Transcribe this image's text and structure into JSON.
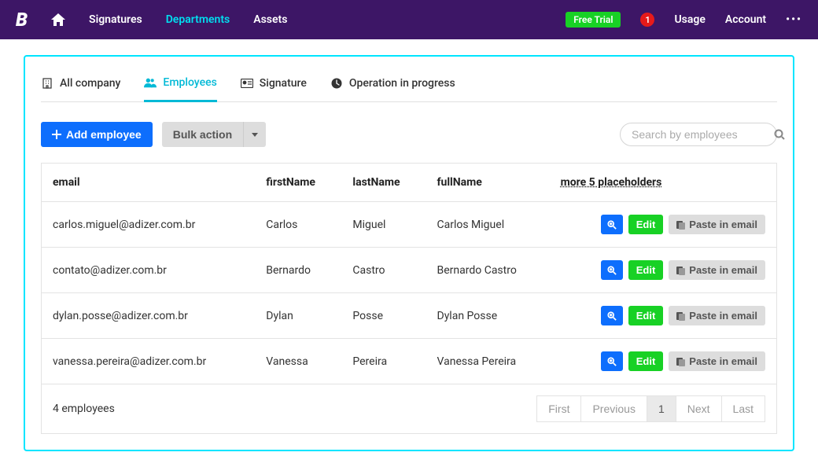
{
  "brand": "B",
  "nav": {
    "items": [
      {
        "label": "Signatures",
        "active": false
      },
      {
        "label": "Departments",
        "active": true
      },
      {
        "label": "Assets",
        "active": false
      }
    ],
    "free_trial": "Free Trial",
    "badge": "1",
    "usage": "Usage",
    "account": "Account",
    "more": "•••"
  },
  "tabs": [
    {
      "label": "All company"
    },
    {
      "label": "Employees"
    },
    {
      "label": "Signature"
    },
    {
      "label": "Operation in progress"
    }
  ],
  "toolbar": {
    "add_employee": "Add employee",
    "bulk_action": "Bulk action",
    "search_placeholder": "Search by employees"
  },
  "table": {
    "headers": {
      "email": "email",
      "firstName": "firstName",
      "lastName": "lastName",
      "fullName": "fullName",
      "more": "more 5 placeholders"
    },
    "rows": [
      {
        "email": "carlos.miguel@adizer.com.br",
        "firstName": "Carlos",
        "lastName": "Miguel",
        "fullName": "Carlos Miguel"
      },
      {
        "email": "contato@adizer.com.br",
        "firstName": "Bernardo",
        "lastName": "Castro",
        "fullName": "Bernardo Castro"
      },
      {
        "email": "dylan.posse@adizer.com.br",
        "firstName": "Dylan",
        "lastName": "Posse",
        "fullName": "Dylan Posse"
      },
      {
        "email": "vanessa.pereira@adizer.com.br",
        "firstName": "Vanessa",
        "lastName": "Pereira",
        "fullName": "Vanessa Pereira"
      }
    ],
    "actions": {
      "edit": "Edit",
      "paste": "Paste in email"
    },
    "count_label": "4 employees"
  },
  "pagination": {
    "first": "First",
    "previous": "Previous",
    "current": "1",
    "next": "Next",
    "last": "Last"
  }
}
